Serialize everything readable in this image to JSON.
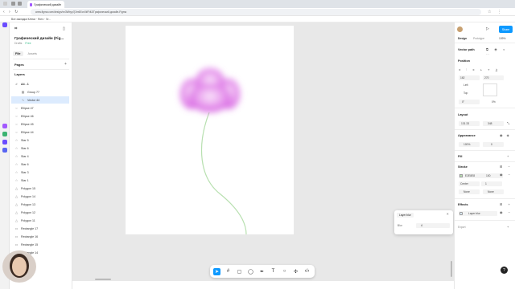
{
  "browser": {
    "tab_title": "Графический дизайн (Fi...",
    "url": "www.figma.com/design/xn3Wbyp7j3m6Ecn0kFNtZ/Графический-дизайн-Figma",
    "bookmarks": "Все закладки   Ключи · Фото · Чт..."
  },
  "left": {
    "file_title": "Графический дизайн (Fig...",
    "draft_label": "Drafts",
    "free_label": "Free",
    "tab_file": "File",
    "tab_assets": "Assets",
    "pages_label": "Pages",
    "layers_label": "Layers",
    "layers": [
      {
        "name": "A4 - 1",
        "glyph": "#",
        "indent": 0,
        "sel": false,
        "bold": true
      },
      {
        "name": "Group 77",
        "glyph": "▦",
        "indent": 8,
        "sel": false,
        "bold": false
      },
      {
        "name": "Vector 44",
        "glyph": "∿",
        "indent": 8,
        "sel": true,
        "bold": false
      },
      {
        "name": "Ellipse 47",
        "glyph": "○",
        "indent": 0,
        "sel": false,
        "bold": false
      },
      {
        "name": "Ellipse 46",
        "glyph": "○",
        "indent": 0,
        "sel": false,
        "bold": false
      },
      {
        "name": "Ellipse 45",
        "glyph": "○",
        "indent": 0,
        "sel": false,
        "bold": false
      },
      {
        "name": "Ellipse 44",
        "glyph": "○",
        "indent": 0,
        "sel": false,
        "bold": false
      },
      {
        "name": "Star 5",
        "glyph": "☆",
        "indent": 0,
        "sel": false,
        "bold": false
      },
      {
        "name": "Star 6",
        "glyph": "☆",
        "indent": 0,
        "sel": false,
        "bold": false
      },
      {
        "name": "Star 4",
        "glyph": "☆",
        "indent": 0,
        "sel": false,
        "bold": false
      },
      {
        "name": "Star 6",
        "glyph": "☆",
        "indent": 0,
        "sel": false,
        "bold": false
      },
      {
        "name": "Star 3",
        "glyph": "☆",
        "indent": 0,
        "sel": false,
        "bold": false
      },
      {
        "name": "Star 1",
        "glyph": "☆",
        "indent": 0,
        "sel": false,
        "bold": false
      },
      {
        "name": "Polygon 15",
        "glyph": "△",
        "indent": 0,
        "sel": false,
        "bold": false
      },
      {
        "name": "Polygon 14",
        "glyph": "△",
        "indent": 0,
        "sel": false,
        "bold": false
      },
      {
        "name": "Polygon 13",
        "glyph": "△",
        "indent": 0,
        "sel": false,
        "bold": false
      },
      {
        "name": "Polygon 12",
        "glyph": "△",
        "indent": 0,
        "sel": false,
        "bold": false
      },
      {
        "name": "Polygon 11",
        "glyph": "△",
        "indent": 0,
        "sel": false,
        "bold": false
      },
      {
        "name": "Rectangle 17",
        "glyph": "▭",
        "indent": 0,
        "sel": false,
        "bold": false
      },
      {
        "name": "Rectangle 16",
        "glyph": "▭",
        "indent": 0,
        "sel": false,
        "bold": false
      },
      {
        "name": "Rectangle 15",
        "glyph": "▭",
        "indent": 0,
        "sel": false,
        "bold": false
      },
      {
        "name": "Rectangle 14",
        "glyph": "▭",
        "indent": 0,
        "sel": false,
        "bold": false
      }
    ]
  },
  "right": {
    "tab_design": "Design",
    "tab_prototype": "Prototype",
    "zoom": "109%",
    "share": "Share",
    "selection_name": "Vector path",
    "position_label": "Position",
    "x": "162",
    "y": "270",
    "align_left": "Left",
    "align_top": "Top",
    "rotation": "0°",
    "rotation_right": "0%",
    "layout_label": "Layout",
    "w": "131.33",
    "h": "348",
    "appearance_label": "Appearance",
    "opacity": "100%",
    "corner": "0",
    "fill_label": "Fill",
    "stroke_label": "Stroke",
    "stroke_color": "E2E8E8",
    "stroke_opacity": "100",
    "stroke_pos": "Center",
    "stroke_width": "1",
    "stroke_start": "None",
    "stroke_end": "None",
    "effects_label": "Effects",
    "effect_name": "Layer blur",
    "export_label": "Export"
  },
  "popup": {
    "effect": "Layer blur",
    "blur_label": "Blur",
    "blur_value": "4"
  },
  "colors": {
    "accent": "#0d99ff",
    "flower": "#e27ee8",
    "stem": "#b8e0b0"
  }
}
